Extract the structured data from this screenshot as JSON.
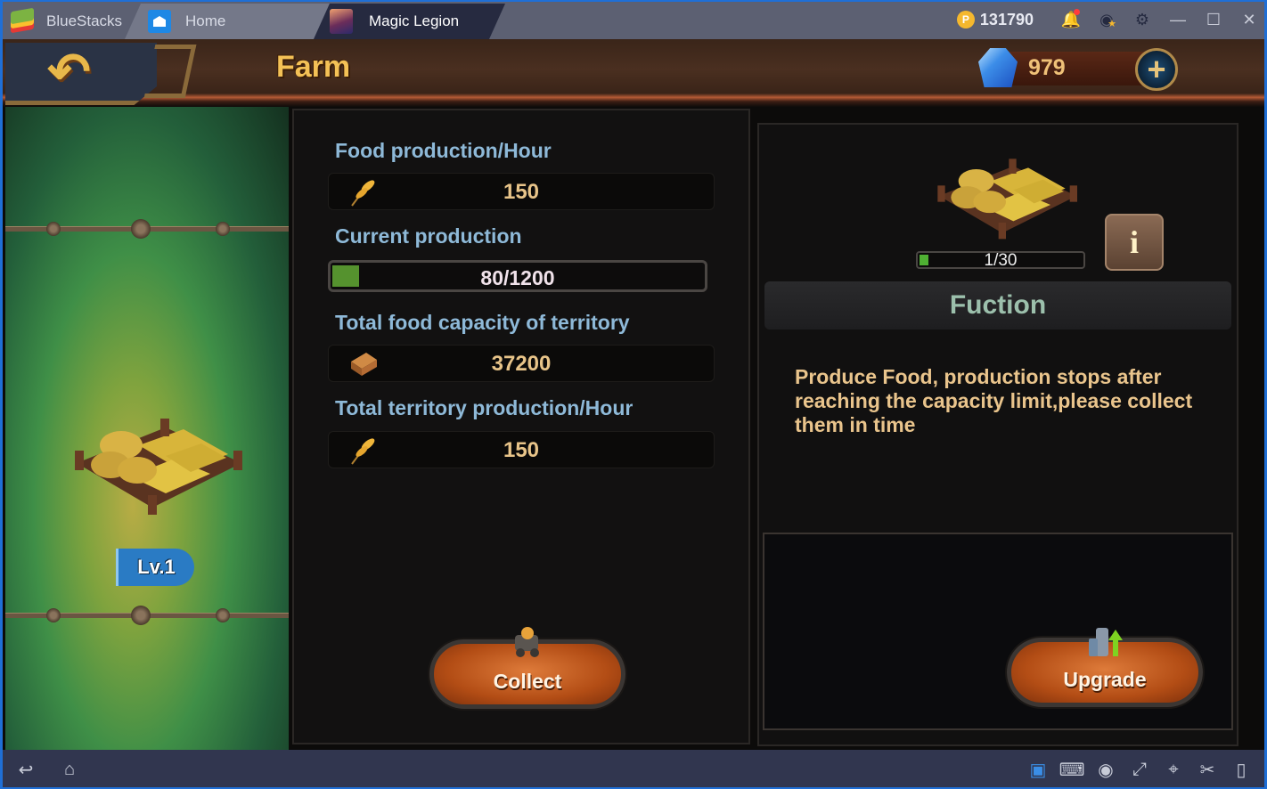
{
  "window": {
    "brand": "BlueStacks",
    "tabs": [
      {
        "label": "Home",
        "icon": "home-icon",
        "active": false
      },
      {
        "label": "Magic Legion",
        "icon": "game-icon",
        "active": true
      }
    ],
    "coins": "131790",
    "controls": [
      "bell-icon",
      "account-star-icon",
      "gear-icon",
      "minimize-icon",
      "maximize-icon",
      "close-icon"
    ]
  },
  "game": {
    "header": {
      "title": "Farm",
      "back_icon": "back-arrow-icon",
      "gems": "979",
      "add_icon": "plus-icon"
    },
    "building": {
      "level_label": "Lv.1"
    },
    "stats": [
      {
        "label": "Food production/Hour",
        "icon": "wheat-icon",
        "value": "150"
      },
      {
        "label": "Current production",
        "type": "progress",
        "value": "80/1200",
        "current": 80,
        "max": 1200
      },
      {
        "label": "Total food capacity of territory",
        "icon": "wood-planks-icon",
        "value": "37200"
      },
      {
        "label": "Total territory production/Hour",
        "icon": "wheat-icon",
        "value": "150"
      }
    ],
    "collect_button": "Collect",
    "info_panel": {
      "count_text": "1/30",
      "count_current": 1,
      "count_max": 30,
      "info_button": "i",
      "section_title": "Fuction",
      "description": "Produce Food, production stops after reaching the capacity limit,please collect them in time"
    },
    "upgrade_button": "Upgrade"
  },
  "navbar": {
    "left": [
      "back-icon",
      "home-icon"
    ],
    "right": [
      "keymap-toggle-icon",
      "keyboard-icon",
      "eye-icon",
      "fullscreen-icon",
      "location-icon",
      "scissors-icon",
      "rotate-icon"
    ]
  },
  "colors": {
    "accent_blue": "#1f6fd6",
    "label_blue": "#8eb9d8",
    "value_gold": "#e8c489",
    "progress_green": "#55922e",
    "button_orange": "#b34d15"
  }
}
